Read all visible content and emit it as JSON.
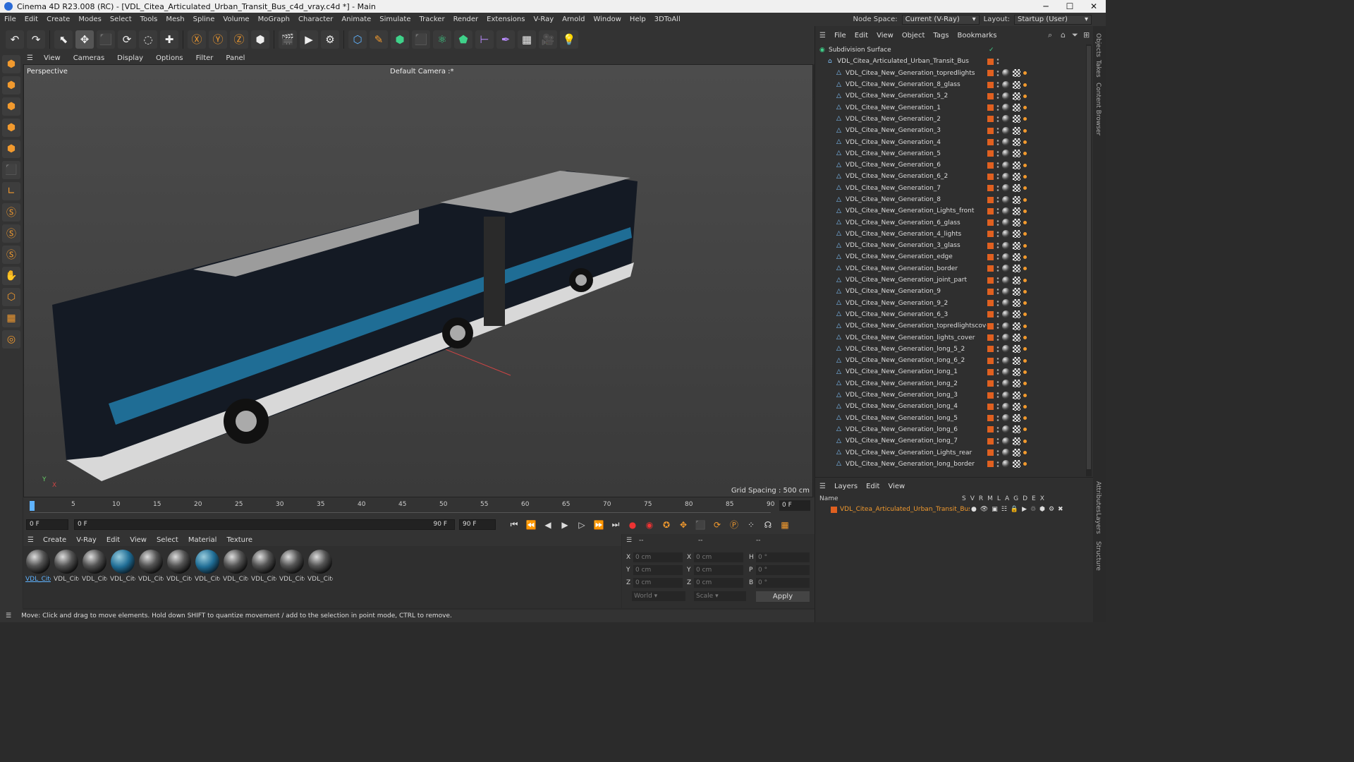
{
  "window": {
    "title": "Cinema 4D R23.008 (RC) - [VDL_Citea_Articulated_Urban_Transit_Bus_c4d_vray.c4d *] - Main",
    "min": "─",
    "max": "☐",
    "close": "✕"
  },
  "menubar": {
    "items": [
      "File",
      "Edit",
      "Create",
      "Modes",
      "Select",
      "Tools",
      "Mesh",
      "Spline",
      "Volume",
      "MoGraph",
      "Character",
      "Animate",
      "Simulate",
      "Tracker",
      "Render",
      "Extensions",
      "V-Ray",
      "Arnold",
      "Window",
      "Help",
      "3DToAll"
    ],
    "node_space_label": "Node Space:",
    "node_space_value": "Current (V-Ray)",
    "layout_label": "Layout:",
    "layout_value": "Startup (User)"
  },
  "toolbar": {
    "icons": [
      "undo-icon",
      "redo-icon",
      "select-icon",
      "move-icon",
      "scale-icon",
      "rotate-icon",
      "live-select-icon",
      "add-icon",
      "x-axis-icon",
      "y-axis-icon",
      "z-axis-icon",
      "coordinate-system-icon",
      "render-region-icon",
      "render-view-icon",
      "render-settings-icon",
      "cube-icon",
      "pen-icon",
      "subdivision-icon",
      "extrude-icon",
      "cloner-icon",
      "instance-icon",
      "deformer-icon",
      "light-icon",
      "camera-icon",
      "floor-icon",
      "bulb-icon"
    ],
    "glyphs": [
      "↶",
      "↷",
      "⬉",
      "✥",
      "⬛",
      "⟳",
      "◌",
      "✚",
      "Ⓧ",
      "Ⓨ",
      "Ⓩ",
      "⬢",
      "🎬",
      "▶",
      "⚙",
      "⬡",
      "✎",
      "⬢",
      "⬛",
      "⚛",
      "⬟",
      "⊢",
      "✒",
      "▦",
      "🎥",
      "💡"
    ]
  },
  "left_tools": {
    "glyphs": [
      "⬢",
      "⬢",
      "⬢",
      "⬢",
      "⬢",
      "⬛",
      "∟",
      "Ⓢ",
      "Ⓢ",
      "Ⓢ",
      "✋",
      "⬡",
      "▦",
      "◎"
    ]
  },
  "viewport": {
    "menu": [
      "View",
      "Cameras",
      "Display",
      "Options",
      "Filter",
      "Panel"
    ],
    "label": "Perspective",
    "camera": "Default Camera :*",
    "grid_spacing": "Grid Spacing : 500 cm"
  },
  "timeline": {
    "ticks": [
      "0",
      "5",
      "10",
      "15",
      "20",
      "25",
      "30",
      "35",
      "40",
      "45",
      "50",
      "55",
      "60",
      "65",
      "70",
      "75",
      "80",
      "85",
      "90"
    ],
    "current_frame": "0 F"
  },
  "transport": {
    "start": "0 F",
    "range_start": "0 F",
    "range_end": "90 F",
    "end": "90 F"
  },
  "materials": {
    "menu": [
      "Create",
      "V-Ray",
      "Edit",
      "View",
      "Select",
      "Material",
      "Texture"
    ],
    "items": [
      "VDL_Cite",
      "VDL_Cite",
      "VDL_Cite",
      "VDL_Cite",
      "VDL_Cite",
      "VDL_Cite",
      "VDL_Cite",
      "VDL_Cite",
      "VDL_Cite",
      "VDL_Cite",
      "VDL_Cite"
    ]
  },
  "attributes": {
    "header": [
      "--",
      "--",
      "--"
    ],
    "rows": [
      {
        "a": "X",
        "v1": "0 cm",
        "b": "X",
        "v2": "0 cm",
        "c": "H",
        "v3": "0 °"
      },
      {
        "a": "Y",
        "v1": "0 cm",
        "b": "Y",
        "v2": "0 cm",
        "c": "P",
        "v3": "0 °"
      },
      {
        "a": "Z",
        "v1": "0 cm",
        "b": "Z",
        "v2": "0 cm",
        "c": "B",
        "v3": "0 °"
      }
    ],
    "world": "World",
    "scale": "Scale",
    "apply": "Apply"
  },
  "status": "Move: Click and drag to move elements. Hold down SHIFT to quantize movement / add to the selection in point mode, CTRL to remove.",
  "objects": {
    "menu": [
      "File",
      "Edit",
      "View",
      "Object",
      "Tags",
      "Bookmarks"
    ],
    "root": "Subdivision Surface",
    "group": "VDL_Citea_Articulated_Urban_Transit_Bus",
    "items": [
      "VDL_Citea_New_Generation_topredlights",
      "VDL_Citea_New_Generation_8_glass",
      "VDL_Citea_New_Generation_5_2",
      "VDL_Citea_New_Generation_1",
      "VDL_Citea_New_Generation_2",
      "VDL_Citea_New_Generation_3",
      "VDL_Citea_New_Generation_4",
      "VDL_Citea_New_Generation_5",
      "VDL_Citea_New_Generation_6",
      "VDL_Citea_New_Generation_6_2",
      "VDL_Citea_New_Generation_7",
      "VDL_Citea_New_Generation_8",
      "VDL_Citea_New_Generation_Lights_front",
      "VDL_Citea_New_Generation_6_glass",
      "VDL_Citea_New_Generation_4_lights",
      "VDL_Citea_New_Generation_3_glass",
      "VDL_Citea_New_Generation_edge",
      "VDL_Citea_New_Generation_border",
      "VDL_Citea_New_Generation_joint_part",
      "VDL_Citea_New_Generation_9",
      "VDL_Citea_New_Generation_9_2",
      "VDL_Citea_New_Generation_6_3",
      "VDL_Citea_New_Generation_topredlightscover",
      "VDL_Citea_New_Generation_lights_cover",
      "VDL_Citea_New_Generation_long_5_2",
      "VDL_Citea_New_Generation_long_6_2",
      "VDL_Citea_New_Generation_long_1",
      "VDL_Citea_New_Generation_long_2",
      "VDL_Citea_New_Generation_long_3",
      "VDL_Citea_New_Generation_long_4",
      "VDL_Citea_New_Generation_long_5",
      "VDL_Citea_New_Generation_long_6",
      "VDL_Citea_New_Generation_long_7",
      "VDL_Citea_New_Generation_Lights_rear",
      "VDL_Citea_New_Generation_long_border"
    ]
  },
  "layers": {
    "menu": [
      "Layers",
      "Edit",
      "View"
    ],
    "name_header": "Name",
    "cols": [
      "S",
      "V",
      "R",
      "M",
      "L",
      "A",
      "G",
      "D",
      "E",
      "X"
    ],
    "row": "VDL_Citea_Articulated_Urban_Transit_Bus"
  },
  "side_tabs": [
    "Objects",
    "Takes",
    "Content Browser",
    "Attributes",
    "Layers",
    "Structure"
  ],
  "colors": {
    "accent": "#f29a2e",
    "selection": "#5fb3ff",
    "bus_blue": "#1f6d95",
    "bus_body": "#141a24"
  }
}
